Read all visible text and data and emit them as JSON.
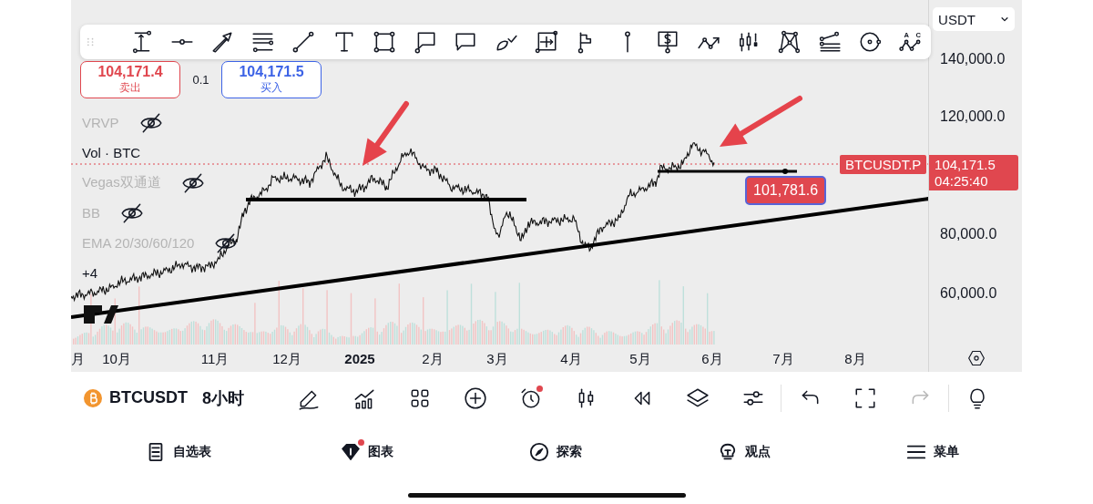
{
  "toolbar": {
    "pattern_labels": [
      "A",
      "C"
    ]
  },
  "currency_select": {
    "value": "USDT"
  },
  "quote": {
    "sell": {
      "price": "104,171.4",
      "label": "卖出"
    },
    "spread": "0.1",
    "buy": {
      "price": "104,171.5",
      "label": "买入"
    }
  },
  "indicators": [
    {
      "name": "VRVP",
      "hidden": true
    },
    {
      "name": "Vol · BTC",
      "hidden": false
    },
    {
      "name": "Vegas双通道",
      "hidden": true
    },
    {
      "name": "BB",
      "hidden": true
    },
    {
      "name": "EMA 20/30/60/120",
      "hidden": true
    }
  ],
  "more_indicators": "+4",
  "price_axis": {
    "ticks": [
      "140,000.0",
      "120,000.0",
      "80,000.0",
      "60,000.0"
    ]
  },
  "last_price": {
    "symbol": "BTCUSDT.P",
    "price": "104,171.5",
    "countdown": "04:25:40"
  },
  "drawing_label": "101,781.6",
  "time_axis": {
    "labels": [
      {
        "text": "月",
        "bold": false
      },
      {
        "text": "10月",
        "bold": false
      },
      {
        "text": "11月",
        "bold": false
      },
      {
        "text": "12月",
        "bold": false
      },
      {
        "text": "2025",
        "bold": true
      },
      {
        "text": "2月",
        "bold": false
      },
      {
        "text": "3月",
        "bold": false
      },
      {
        "text": "4月",
        "bold": false
      },
      {
        "text": "5月",
        "bold": false
      },
      {
        "text": "6月",
        "bold": false
      },
      {
        "text": "7月",
        "bold": false
      },
      {
        "text": "8月",
        "bold": false
      }
    ]
  },
  "bottom_toolbar": {
    "symbol": "BTCUSDT",
    "interval": "8小时",
    "alert_badge": true,
    "redo_disabled": true
  },
  "nav": [
    {
      "label": "自选表",
      "badge": false
    },
    {
      "label": "图表",
      "badge": true
    },
    {
      "label": "探索",
      "badge": false
    },
    {
      "label": "观点",
      "badge": false
    },
    {
      "label": "菜单",
      "badge": false
    }
  ]
}
